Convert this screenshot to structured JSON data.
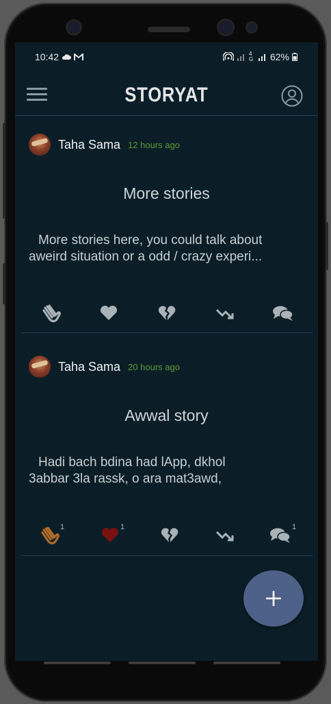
{
  "status_bar": {
    "time": "10:42",
    "network": "4G",
    "battery": "62%"
  },
  "app": {
    "title": "STORYAT"
  },
  "posts": [
    {
      "author": "Taha Sama",
      "time": "12 hours ago",
      "title": "More stories",
      "body_line1": "More stories here, you could talk about",
      "body_line2": "aweird situation or a odd / crazy experi...",
      "counts": {
        "clap": "",
        "heart": "",
        "broken_heart": "",
        "trend_down": "",
        "comment": ""
      },
      "colors": {
        "clap": "#aab2b8",
        "heart": "#aab2b8"
      }
    },
    {
      "author": "Taha Sama",
      "time": "20 hours ago",
      "title": "Awwal story",
      "body_line1": "Hadi bach bdina had lApp, dkhol",
      "body_line2": "3abbar 3la rassk, o ara mat3awd,",
      "counts": {
        "clap": "1",
        "heart": "1",
        "broken_heart": "",
        "trend_down": "",
        "comment": "1"
      },
      "colors": {
        "clap": "#b06a28",
        "heart": "#7a1010"
      }
    }
  ],
  "fab": {
    "icon": "plus-icon",
    "color": "#4d6087"
  }
}
